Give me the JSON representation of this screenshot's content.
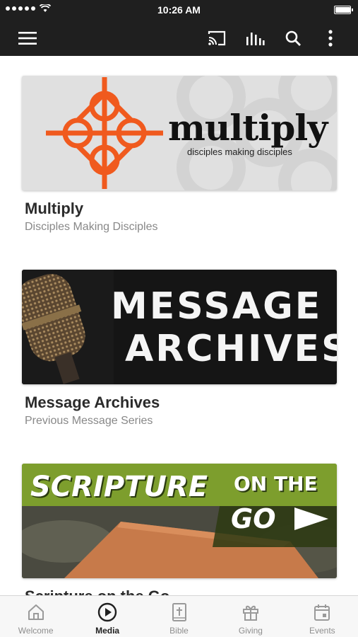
{
  "status_bar": {
    "time": "10:26 AM",
    "signal_icon": "signal-dots-icon",
    "wifi_icon": "wifi-icon",
    "battery_icon": "battery-icon",
    "battery_level": 0.95
  },
  "app_bar": {
    "icons": [
      "menu-icon",
      "cast-icon",
      "audio-bars-icon",
      "search-icon",
      "more-vert-icon"
    ],
    "background": "#1f1f1f"
  },
  "cards": [
    {
      "title": "Multiply",
      "subtitle": "Disciples Making Disciples",
      "image_text": "multiply",
      "image_tagline": "disciples making disciples",
      "accent": "#f05a1e"
    },
    {
      "title": "Message Archives",
      "subtitle": "Previous Message Series",
      "image_text_line1": "MESSAGE",
      "image_text_line2": "ARCHIVES"
    },
    {
      "title": "Scripture on the Go",
      "image_text_line1": "SCRIPTURE",
      "image_text_line2": "ON THE",
      "image_text_line3": "GO"
    }
  ],
  "tabs": [
    {
      "label": "Welcome",
      "icon": "home-icon",
      "active": false
    },
    {
      "label": "Media",
      "icon": "play-circle-icon",
      "active": true
    },
    {
      "label": "Bible",
      "icon": "bible-icon",
      "active": false
    },
    {
      "label": "Giving",
      "icon": "gift-icon",
      "active": false
    },
    {
      "label": "Events",
      "icon": "calendar-icon",
      "active": false
    }
  ]
}
